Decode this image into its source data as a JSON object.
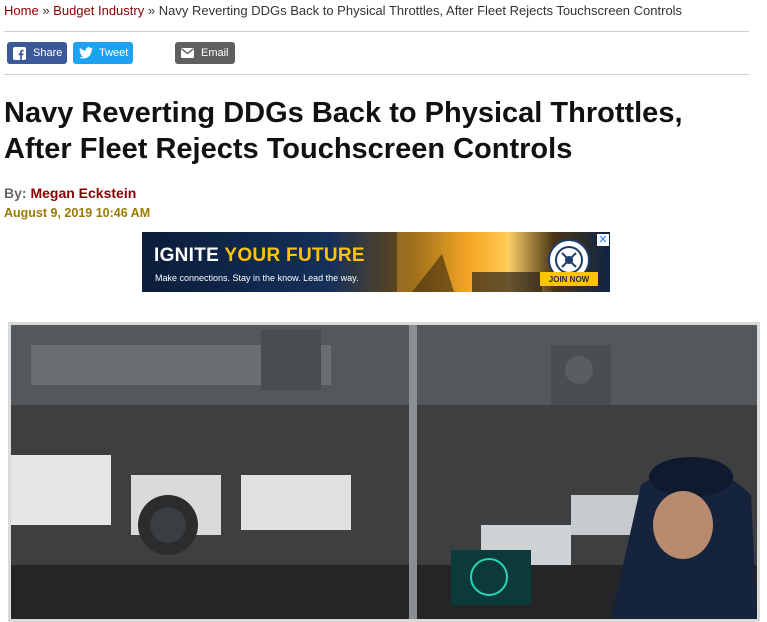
{
  "breadcrumb": {
    "home": "Home",
    "sep1": "»",
    "section": "Budget Industry",
    "sep2": "»",
    "current": "Navy Reverting DDGs Back to Physical Throttles, After Fleet Rejects Touchscreen Controls"
  },
  "share": {
    "facebook_label": "Share",
    "twitter_label": "Tweet",
    "email_label": "Email",
    "facebook_color": "#3b5998",
    "twitter_color": "#1da1f2",
    "email_color": "#5f5f5f"
  },
  "article": {
    "title": "Navy Reverting DDGs Back to Physical Throttles, After Fleet Rejects Touchscreen Controls",
    "by_label": "By:",
    "author": "Megan Eckstein",
    "date": "August 9, 2019 10:46 AM"
  },
  "ad": {
    "headline_white": "IGNITE ",
    "headline_yellow": "YOUR FUTURE",
    "subline": "Make connections. Stay in the know. Lead the way.",
    "cta": "JOIN NOW",
    "close": "✕"
  },
  "colors": {
    "link": "#8b0000",
    "date": "#9a7a00"
  }
}
